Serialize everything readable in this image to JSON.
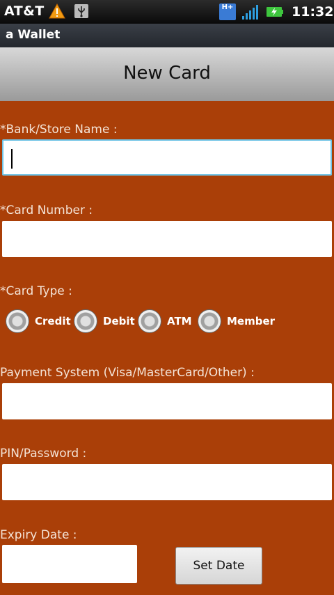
{
  "status_bar": {
    "carrier": "AT&T",
    "time": "11:32",
    "network_type": "H+",
    "icons": [
      "warning-icon",
      "usb-icon",
      "hplus-network-icon",
      "signal-icon",
      "battery-charging-icon"
    ]
  },
  "app": {
    "title": "a Wallet"
  },
  "header": {
    "title": "New Card"
  },
  "form": {
    "bank_label": "*Bank/Store Name :",
    "bank_value": "",
    "card_number_label": "*Card Number :",
    "card_number_value": "",
    "card_type_label": "*Card Type :",
    "card_types": [
      "Credit",
      "Debit",
      "ATM",
      "Member"
    ],
    "payment_system_label": "Payment System (Visa/MasterCard/Other) :",
    "payment_system_value": "",
    "pin_label": "PIN/Password :",
    "pin_value": "",
    "expiry_label": "Expiry Date :",
    "expiry_value": "",
    "set_date_button": "Set Date"
  },
  "colors": {
    "form_background": "#aa3f08",
    "focus_border": "#6fc4e6"
  }
}
